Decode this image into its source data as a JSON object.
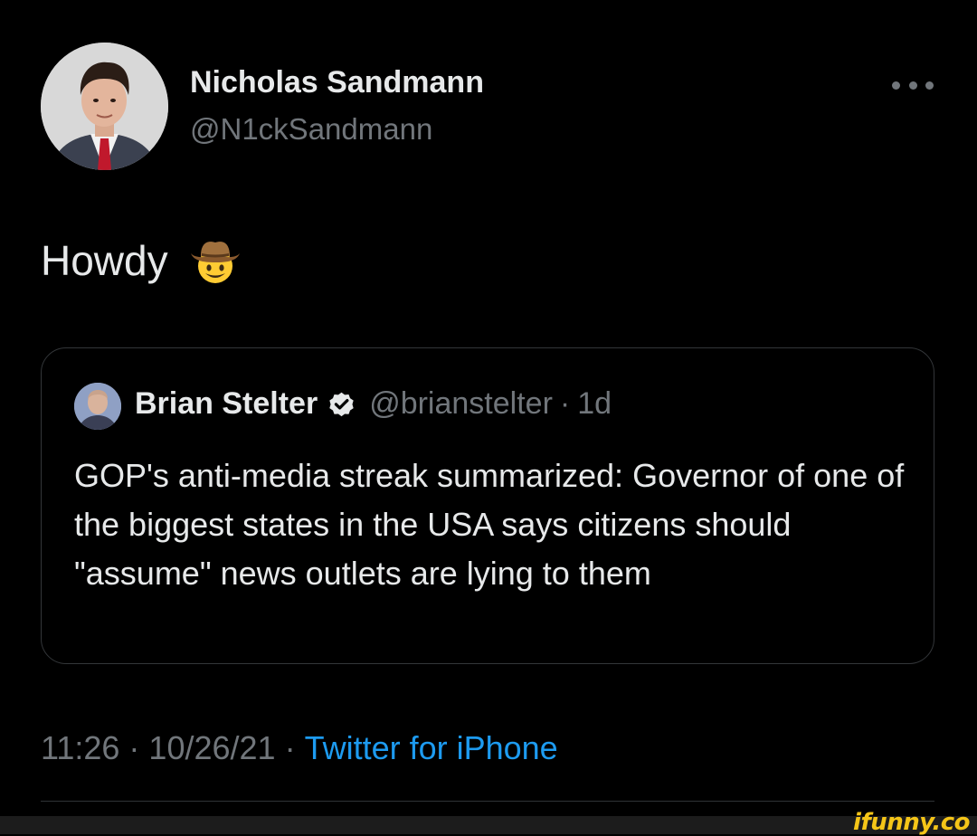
{
  "tweet": {
    "author": {
      "name": "Nicholas Sandmann",
      "handle": "@N1ckSandmann",
      "avatar_icon": "profile-photo"
    },
    "text": "Howdy",
    "emoji": "cowboy-hat-face",
    "more_icon": "ellipsis-icon",
    "quoted": {
      "name": "Brian Stelter",
      "verified": true,
      "handle": "@brianstelter",
      "separator": "·",
      "time": "1d",
      "text": "GOP's anti-media streak summarized: Governor of one of the biggest states in the USA says citizens should \"assume\" news outlets are lying to them"
    },
    "meta": {
      "time": "11:26",
      "separator": "·",
      "date": "10/26/21",
      "source": "Twitter for iPhone"
    }
  },
  "watermark": "ifunny.co",
  "colors": {
    "background": "#000000",
    "primary_text": "#e7e9ea",
    "secondary_text": "#71767b",
    "link": "#1d9bf0",
    "border": "#333639",
    "verified_badge": "#e7e9ea",
    "watermark": "#f5c518"
  }
}
